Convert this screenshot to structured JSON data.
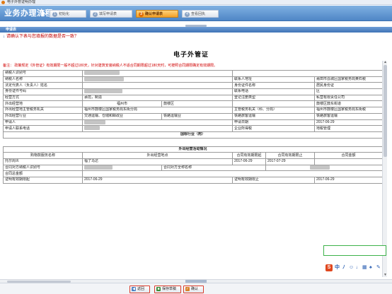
{
  "window": {
    "title": "电子外管证明办理"
  },
  "flow": {
    "title": "业务办理流程",
    "steps": [
      {
        "num": "1",
        "label": "初始化"
      },
      {
        "num": "2",
        "label": "填写申请表"
      },
      {
        "num": "3",
        "label": "确认申请表"
      },
      {
        "num": "4",
        "label": "查看回执"
      }
    ],
    "active_step": 3
  },
  "section": {
    "title": "申请表"
  },
  "instruction": {
    "arrow": "↓",
    "text": "请确认下表与您填报的数据是否一致？"
  },
  "doc": {
    "title": "电子外管证",
    "note": "备注：   政策规定《外管证》有效期限一般不超过180天，针对建筑安装纳税人不适合同期限超过180天时，可按照合同期限确定有效期限。",
    "rows": [
      {
        "l1": "纳税人识别号",
        "v1": "",
        "l2": "",
        "v2": ""
      },
      {
        "l1": "纳税人名称",
        "v1": "",
        "l2": "联系人地址",
        "v2": "莆田市荔城区国家税务局黄石税"
      },
      {
        "l1": "法定代表人（负责人）姓名",
        "v1": "",
        "l2": "身份证件名称",
        "v2": "居民身份证"
      },
      {
        "l1": "身份证件号码",
        "v1": "",
        "l2": "联系电话",
        "v2": "区"
      },
      {
        "l1": "经营方式",
        "v1": "承揽，制造",
        "l2": "登记注册类型",
        "v2": "私营有限责任公司"
      },
      {
        "l1": "外出经营地",
        "v1": "福州市",
        "v1b": "鼓楼区",
        "l2": "",
        "v2": "鼓楼区鼓东街道"
      },
      {
        "l1": "外出经营地主管税务机关",
        "v1": "福州市鼓楼区国家税务局东街分局",
        "l2": "主管税务机关（科、分局）",
        "v2": "福州市鼓楼区国家税务局东街税"
      },
      {
        "l1": "外出经营行业",
        "v1": "交通运输、仓储和邮政业",
        "v1b": "铁路运输业",
        "l2": "铁路旅客运输",
        "v2": "铁路旅客运输"
      },
      {
        "l1": "申请人",
        "v1": "",
        "l2": "申请日期",
        "v2": "2017-06-29"
      },
      {
        "l1": "申请人联系电话",
        "v1": "",
        "l2": "企业所得税",
        "v2": "地税管理"
      }
    ],
    "guobiao": "国标行业（附）",
    "activity_title": "外出经营活动情况",
    "activity_headers": [
      "购物款服务名称",
      "外出经营地点",
      "合同有效期限起",
      "合同有效期限止",
      "合同金额"
    ],
    "activity_row": {
      "name": "托尔周炎",
      "place": "福了马达",
      "start": "2017-06-29",
      "end": "2017-07-29",
      "amount": ""
    },
    "contract_rows": {
      "party_id_label": "合同对方纳税人识别号",
      "party_name_label": "合同对方全称名称",
      "total_label": "合同总金额",
      "valid_from_label": "证明有效期限起",
      "valid_from": "2017-06-29",
      "valid_to_label": "证明有效期限止",
      "valid_to": "2017-06-29"
    }
  },
  "buttons": {
    "back": "返回",
    "save_draft": "保存草稿",
    "confirm": "确认"
  },
  "colors": {
    "flow_bar": "#4f86c6",
    "active_step": "#f3a12a",
    "note_red": "#d00000",
    "button_border": "#d93a2b",
    "green_box": "#3db24a"
  }
}
